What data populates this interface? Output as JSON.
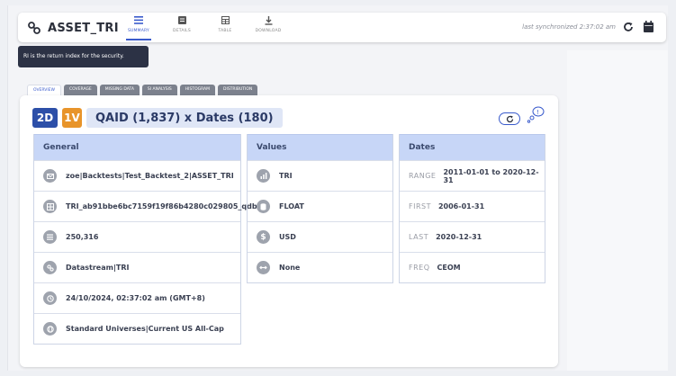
{
  "header": {
    "title": "ASSET_TRI",
    "tabs": [
      {
        "label": "SUMMARY",
        "icon": "list-icon",
        "active": true
      },
      {
        "label": "DETAILS",
        "icon": "details-icon",
        "active": false
      },
      {
        "label": "TABLE",
        "icon": "table-icon",
        "active": false
      },
      {
        "label": "DOWNLOAD",
        "icon": "download-icon",
        "active": false
      }
    ],
    "sync_text": "last synchronized 2:37:02 am"
  },
  "tooltip": "RI is the return index for the security.",
  "subtabs": [
    "OVERVIEW",
    "COVERAGE",
    "MISSING DATA",
    "SI ANALYSIS",
    "HISTOGRAM",
    "DISTRIBUTION"
  ],
  "badges": {
    "b1": "2D",
    "b2": "1V",
    "dims": "QAID (1,837) x Dates (180)"
  },
  "colors": {
    "primary": "#2c4fa8",
    "accent": "#e8942a",
    "header_blue": "#c7d6f7",
    "tooltip_bg": "#2c3245"
  },
  "general": {
    "title": "General",
    "rows": [
      {
        "icon": "mail-icon",
        "text": "zoe|Backtests|Test_Backtest_2|ASSET_TRI"
      },
      {
        "icon": "grid-icon",
        "text": "TRI_ab91bbe6bc7159f19f86b4280c029805_qdb"
      },
      {
        "icon": "list-icon",
        "text": "250,316"
      },
      {
        "icon": "link-icon",
        "text": "Datastream|TRI"
      },
      {
        "icon": "clock-icon",
        "text": "24/10/2024, 02:37:02 am (GMT+8)"
      },
      {
        "icon": "globe-icon",
        "text": "Standard Universes|Current US All-Cap"
      }
    ]
  },
  "values": {
    "title": "Values",
    "rows": [
      {
        "icon": "chart-icon",
        "text": "TRI"
      },
      {
        "icon": "database-icon",
        "text": "FLOAT"
      },
      {
        "icon": "dollar-icon",
        "text": "USD"
      },
      {
        "icon": "arrows-icon",
        "text": "None"
      }
    ]
  },
  "dates": {
    "title": "Dates",
    "rows": [
      {
        "key": "RANGE",
        "value": "2011-01-01 to 2020-12-31"
      },
      {
        "key": "FIRST",
        "value": "2006-01-31"
      },
      {
        "key": "LAST",
        "value": "2020-12-31"
      },
      {
        "key": "FREQ",
        "value": "CEOM"
      }
    ]
  }
}
